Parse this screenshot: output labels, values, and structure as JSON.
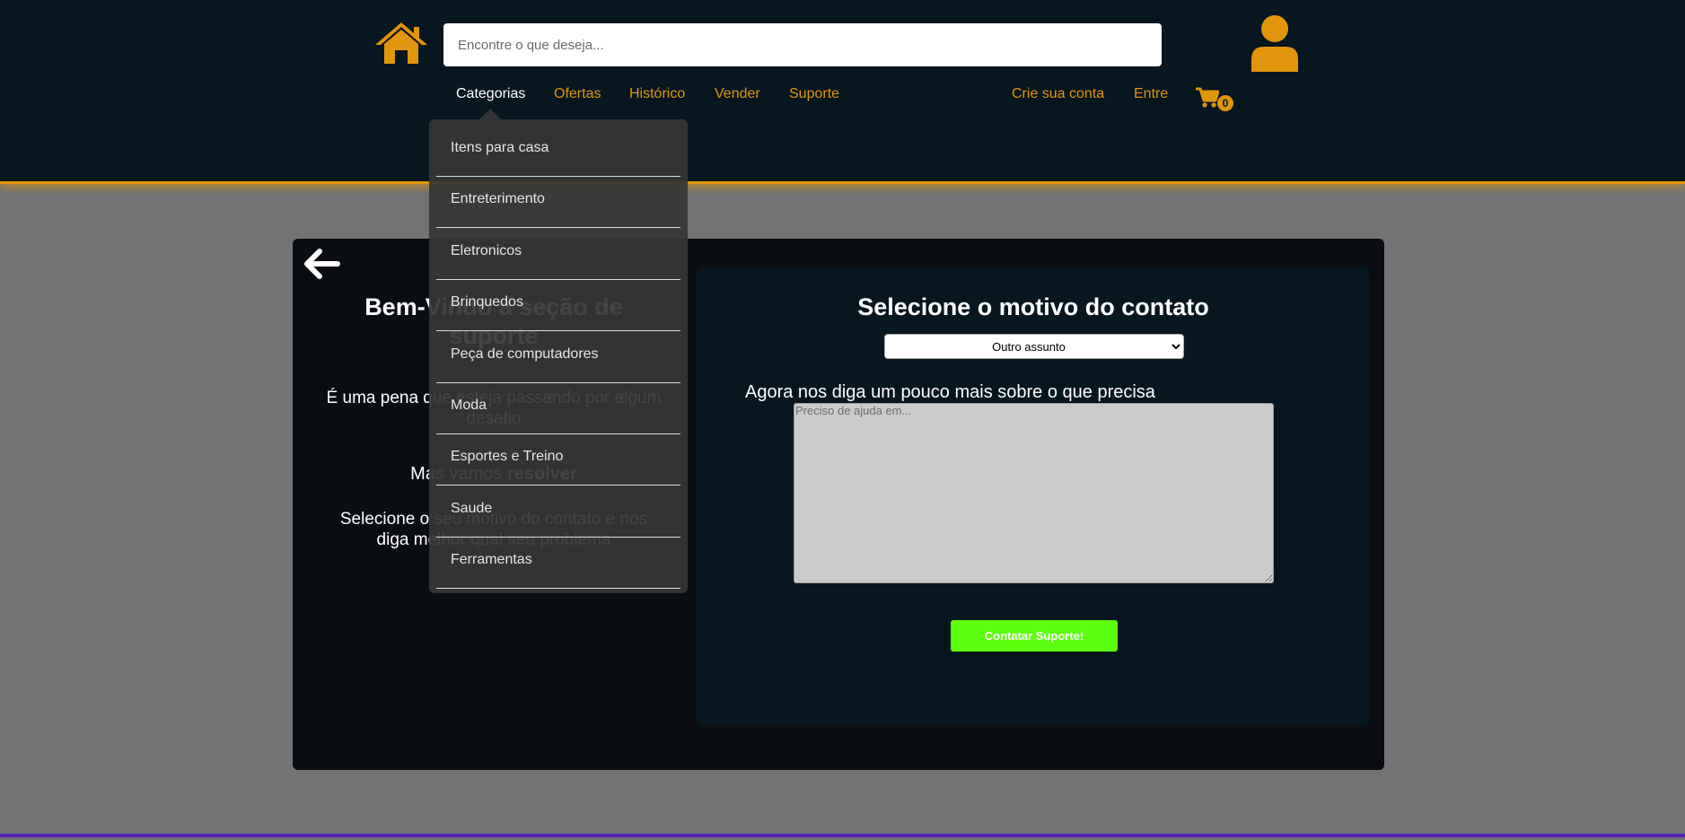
{
  "header": {
    "search_placeholder": "Encontre o que deseja...",
    "nav": [
      {
        "label": "Categorias"
      },
      {
        "label": "Ofertas"
      },
      {
        "label": "Histórico"
      },
      {
        "label": "Vender"
      },
      {
        "label": "Suporte"
      }
    ],
    "account": {
      "create_label": "Crie sua conta",
      "login_label": "Entre"
    },
    "cart_count": "0"
  },
  "categories_menu": {
    "items": [
      {
        "label": "Itens para casa"
      },
      {
        "label": "Entreterimento"
      },
      {
        "label": "Eletronicos"
      },
      {
        "label": "Brinquedos"
      },
      {
        "label": "Peça de computadores"
      },
      {
        "label": "Moda"
      },
      {
        "label": "Esportes e Treino"
      },
      {
        "label": "Saude"
      },
      {
        "label": "Ferramentas"
      }
    ]
  },
  "support": {
    "welcome_title": "Bem-Vindo a seção de suporte",
    "sorry_text": "É uma pena que esteja passando por algum desafio",
    "resolve_prefix": "Mas vamos",
    "resolve_bold": "resolver",
    "instructions": "Selecione o seu motivo do contato e nos diga melhor qual seu problema",
    "form_title": "Selecione o motivo do contato",
    "reason_selected": "Outro assunto",
    "details_label": "Agora nos diga um pouco mais sobre o que precisa",
    "details_placeholder": "Preciso de ajuda em...",
    "submit_label": "Contatar Suporte!"
  },
  "colors": {
    "accent": "#e0950d",
    "header_bg": "#07161f",
    "submit_bg": "#5cff0d",
    "page_bg": "#737373"
  },
  "icons": [
    "home-icon",
    "user-icon",
    "cart-icon",
    "back-arrow-icon"
  ]
}
